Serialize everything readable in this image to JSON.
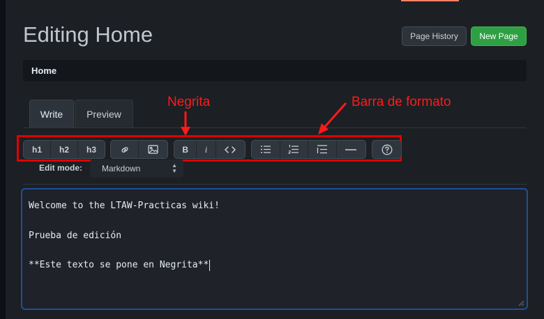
{
  "page": {
    "title": "Editing Home"
  },
  "header": {
    "history_label": "Page History",
    "new_page_label": "New Page"
  },
  "breadcrumb": {
    "text": "Home"
  },
  "tabs": [
    {
      "label": "Write",
      "active": true
    },
    {
      "label": "Preview",
      "active": false
    }
  ],
  "annotations": {
    "negrita": "Negrita",
    "barra": "Barra de formato",
    "color": "#ff1a1a"
  },
  "toolbar": {
    "groups": [
      [
        {
          "icon": "h1-icon",
          "label": "h1"
        },
        {
          "icon": "h2-icon",
          "label": "h2"
        },
        {
          "icon": "h3-icon",
          "label": "h3"
        }
      ],
      [
        {
          "icon": "link-icon"
        },
        {
          "icon": "image-icon"
        }
      ],
      [
        {
          "icon": "bold-icon",
          "label": "B"
        },
        {
          "icon": "italic-icon",
          "label": "i"
        },
        {
          "icon": "code-icon"
        }
      ],
      [
        {
          "icon": "bullet-list-icon"
        },
        {
          "icon": "numbered-list-icon"
        },
        {
          "icon": "blockquote-icon"
        },
        {
          "icon": "horizontal-rule-icon"
        }
      ],
      [
        {
          "icon": "help-icon"
        }
      ]
    ]
  },
  "edit_mode": {
    "label": "Edit mode:",
    "value": "Markdown"
  },
  "editor": {
    "lines": [
      "Welcome to the LTAW-Practicas wiki!",
      "",
      "Prueba de edición",
      "",
      "**Este texto se pone en Negrita**"
    ]
  },
  "colors": {
    "accent_green": "#2ea043",
    "focus_border": "#1f4f9c",
    "background": "#1c1f24"
  }
}
